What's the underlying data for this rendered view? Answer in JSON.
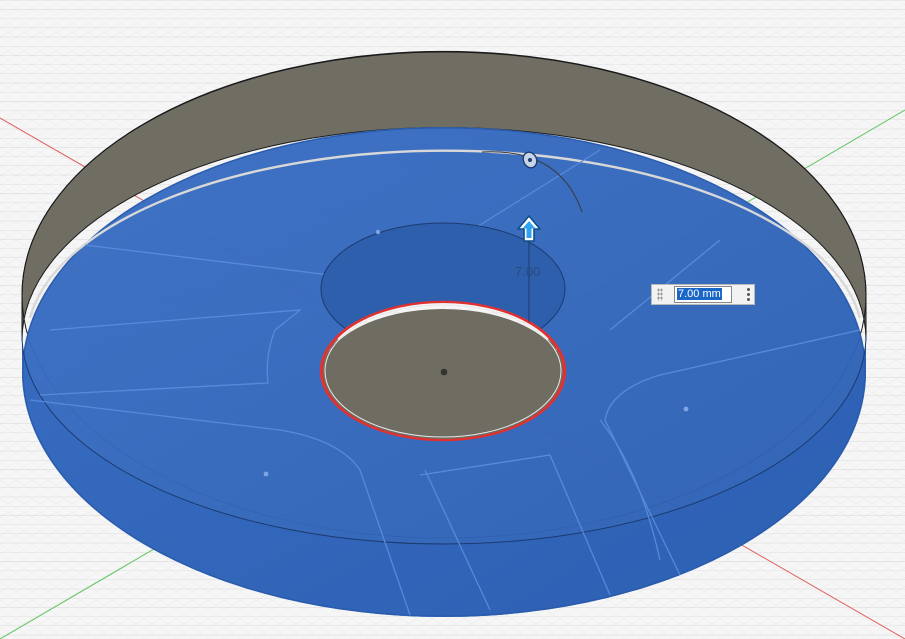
{
  "viewport": {
    "dimension_label": "7.00",
    "manipulator_icon": "arrow-up-icon",
    "rotate_handle_icon": "rotate-handle-icon"
  },
  "dimension_input": {
    "value": "7.00 mm",
    "more_icon": "more-vertical-icon"
  },
  "colors": {
    "selected_face": "#2f63b8",
    "body_side": "#6f6c62",
    "grid_line": "#d4d4d4",
    "axis_red": "#e05050",
    "axis_green": "#50c050",
    "hole_edge_highlight": "#e03030",
    "manipulator_arrow": "#1e8fe0"
  }
}
